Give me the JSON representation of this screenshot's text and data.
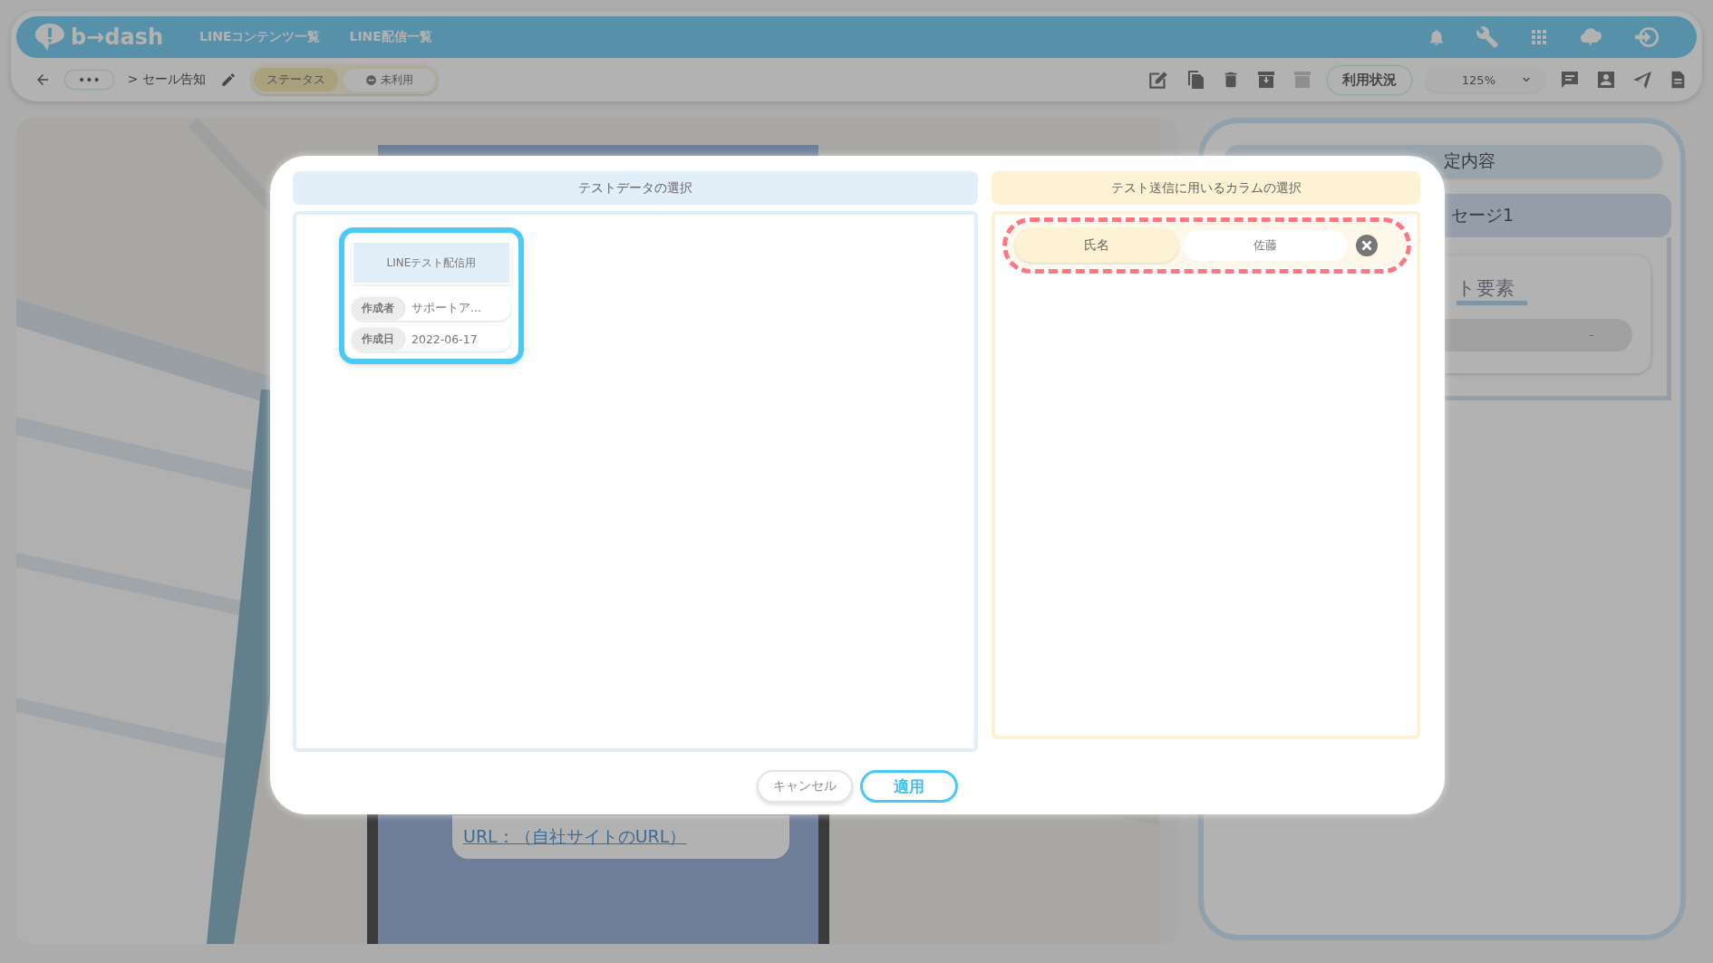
{
  "header": {
    "logo": "b→dash",
    "nav": [
      "LINEコンテンツ一覧",
      "LINE配信一覧"
    ]
  },
  "toolbar": {
    "more": "•••",
    "breadcrumb": "> セール告知",
    "status_label": "ステータス",
    "status_value": "未利用",
    "usage_button": "利用状況",
    "zoom": "125%"
  },
  "canvas": {
    "link": "URL：（自社サイトのURL）"
  },
  "side_panel": {
    "items": [
      {
        "kind": "pill",
        "text": "定内容"
      },
      {
        "kind": "tab",
        "text": "セージ1"
      },
      {
        "kind": "heading",
        "text": "ト要素"
      },
      {
        "kind": "field",
        "text": "-"
      }
    ]
  },
  "modal": {
    "left": {
      "title": "テストデータの選択",
      "cards": [
        {
          "title": "LINEテスト配信用",
          "selected": true,
          "fields": [
            {
              "label": "作成者",
              "value": "サポートア..."
            },
            {
              "label": "作成日",
              "value": "2022-06-17"
            }
          ]
        }
      ]
    },
    "right": {
      "title": "テスト送信に用いるカラムの選択",
      "columns": [
        {
          "name": "氏名",
          "value": "佐藤",
          "highlighted": true
        }
      ]
    },
    "buttons": [
      {
        "label": "キャンセル",
        "kind": "cancel"
      },
      {
        "label": "適用",
        "kind": "primary"
      }
    ]
  }
}
